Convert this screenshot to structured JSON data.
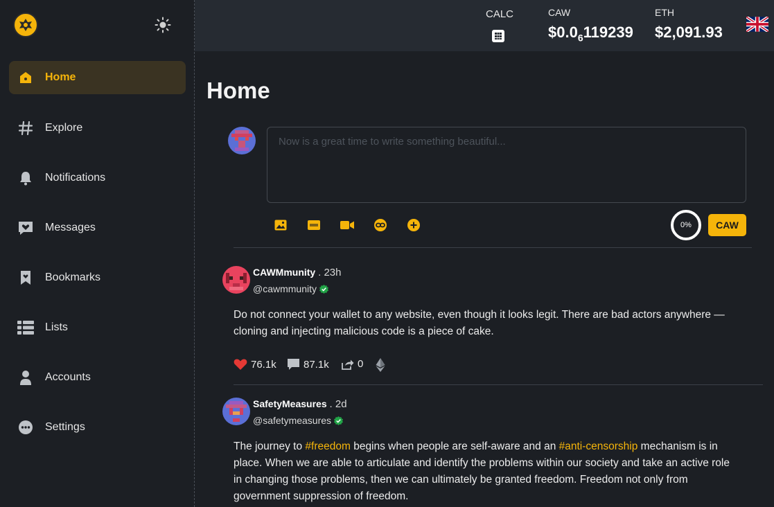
{
  "sidebar": {
    "items": [
      {
        "label": "Home",
        "icon": "home-icon",
        "active": true
      },
      {
        "label": "Explore",
        "icon": "hash-icon"
      },
      {
        "label": "Notifications",
        "icon": "bell-icon"
      },
      {
        "label": "Messages",
        "icon": "message-heart-icon"
      },
      {
        "label": "Bookmarks",
        "icon": "bookmark-icon"
      },
      {
        "label": "Lists",
        "icon": "list-icon"
      },
      {
        "label": "Accounts",
        "icon": "user-icon"
      },
      {
        "label": "Settings",
        "icon": "more-dots-icon"
      }
    ]
  },
  "topbar": {
    "calc_label": "CALC",
    "caw_label": "CAW",
    "caw_price_prefix": "$0.0",
    "caw_price_sub": "6",
    "caw_price_suffix": "119239",
    "eth_label": "ETH",
    "eth_price": "$2,091.93"
  },
  "main": {
    "title": "Home",
    "composer": {
      "placeholder": "Now is a great time to write something beautiful...",
      "progress": "0%",
      "submit_label": "CAW"
    }
  },
  "posts": [
    {
      "name": "CAWMmunity",
      "time": ". 23h",
      "handle": "@cawmmunity",
      "body": "Do not connect your wallet to any website, even though it looks legit. There are bad actors anywhere —cloning and injecting malicious code is a piece of cake.",
      "likes": "76.1k",
      "comments": "87.1k",
      "shares": "0"
    },
    {
      "name": "SafetyMeasures",
      "time": ". 2d",
      "handle": "@safetymeasures",
      "body_parts": [
        "The journey to ",
        "#freedom",
        " begins when people are self-aware and an ",
        "#anti-censorship",
        " mechanism is in place. When we are able to articulate and identify the problems within our society and take an active role in changing those problems, then we can ultimately be granted freedom. Freedom not only from government suppression of freedom."
      ]
    }
  ],
  "colors": {
    "accent": "#f5b40a",
    "background": "#1c1f24",
    "topbar": "#262b32",
    "verified": "#22a447",
    "like": "#e53935"
  }
}
